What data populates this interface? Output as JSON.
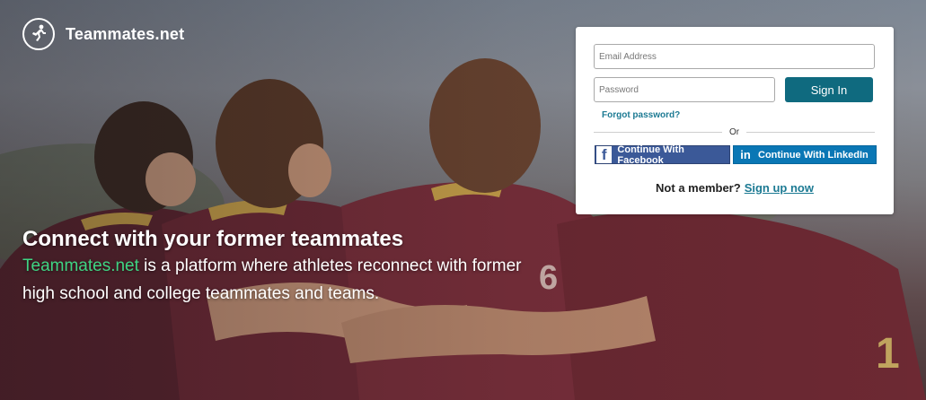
{
  "brand": {
    "name": "Teammates.net",
    "icon": "runner-icon"
  },
  "hero": {
    "headline": "Connect with your former teammates",
    "brand_highlight": "Teammates.net",
    "description": " is a platform where athletes reconnect with former high school and college teammates and teams."
  },
  "login": {
    "email_placeholder": "Email Address",
    "password_placeholder": "Password",
    "signin_label": "Sign In",
    "forgot_label": "Forgot password?",
    "or_label": "Or",
    "facebook_label": "Continue With Facebook",
    "linkedin_label": "Continue With LinkedIn",
    "member_prompt": "Not a member?",
    "signup_label": "Sign up now"
  },
  "colors": {
    "signin_button": "#0f6a7f",
    "link": "#1c7a93",
    "brand_green": "#3fd483",
    "facebook": "#3b5998",
    "linkedin": "#0a77b5"
  }
}
